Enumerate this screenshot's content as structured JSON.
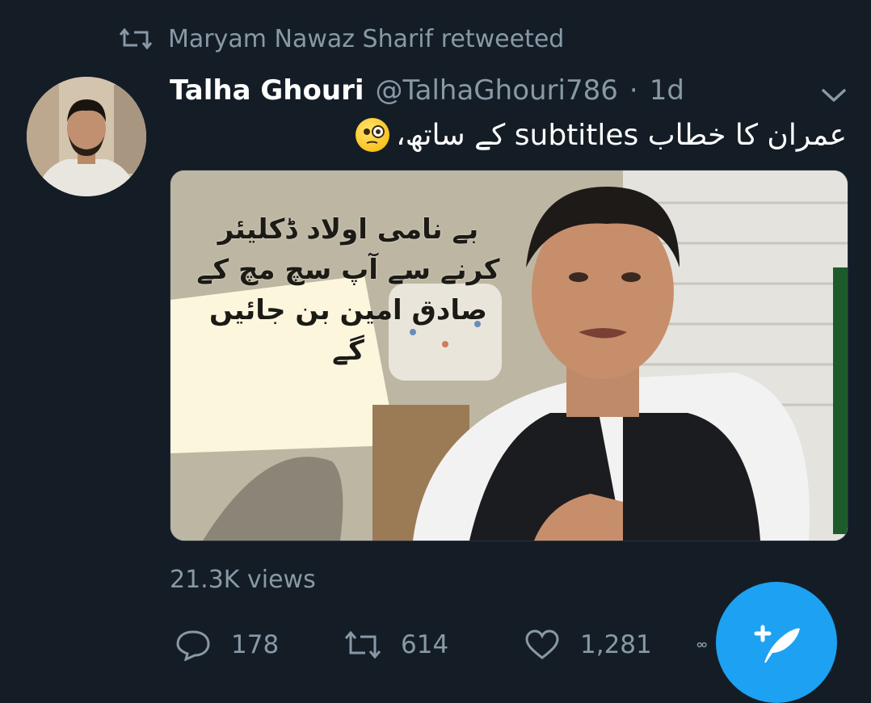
{
  "retweet": {
    "icon": "retweet-icon",
    "text": "Maryam Nawaz Sharif retweeted"
  },
  "tweet": {
    "display_name": "Talha Ghouri",
    "handle": "@TalhaGhouri786",
    "separator": "·",
    "time": "1d",
    "text": "عمران کا خطاب subtitles کے ساتھ،",
    "emoji": "face-with-monocle-emoji",
    "media": {
      "subtitle_lines": [
        "بے نامی اولاد ڈکلیئر",
        "کرنے سے آپ سچ مچ کے",
        "صادق امین بن جائیں گے"
      ]
    },
    "views": "21.3K views"
  },
  "actions": {
    "reply_count": "178",
    "retweet_count": "614",
    "like_count": "1,281"
  },
  "colors": {
    "background": "#141d26",
    "secondary_text": "#8899a6",
    "accent": "#1da1f2"
  }
}
